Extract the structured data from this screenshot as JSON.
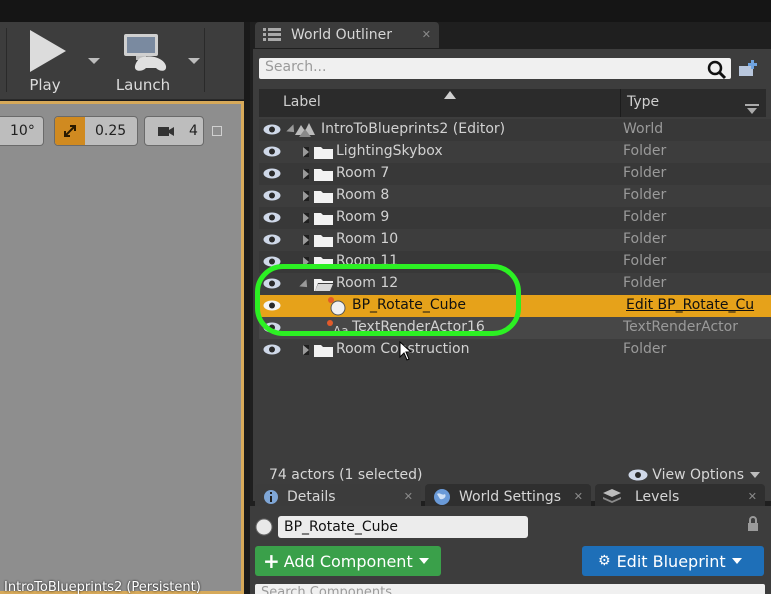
{
  "toolbar": {
    "play_label": "Play",
    "launch_label": "Launch"
  },
  "viewport": {
    "angle_value": "10°",
    "scale_value": "0.25",
    "camera_speed": "4",
    "status_text": "IntroToBlueprints2 (Persistent)"
  },
  "outliner": {
    "tab_label": "World Outliner",
    "search_placeholder": "Search...",
    "col_label": "Label",
    "col_type": "Type",
    "rows": [
      {
        "label": "IntroToBlueprints2 (Editor)",
        "type": "World"
      },
      {
        "label": "LightingSkybox",
        "type": "Folder"
      },
      {
        "label": "Room 7",
        "type": "Folder"
      },
      {
        "label": "Room 8",
        "type": "Folder"
      },
      {
        "label": "Room 9",
        "type": "Folder"
      },
      {
        "label": "Room 10",
        "type": "Folder"
      },
      {
        "label": "Room 11",
        "type": "Folder"
      },
      {
        "label": "Room 12",
        "type": "Folder"
      },
      {
        "label": "BP_Rotate_Cube",
        "type": "Edit BP_Rotate_Cu"
      },
      {
        "label": "TextRenderActor16",
        "type": "TextRenderActor"
      },
      {
        "label": "Room Construction",
        "type": "Folder"
      }
    ],
    "actor_count": "74 actors (1 selected)",
    "view_options": "View Options"
  },
  "lower_tabs": {
    "details": "Details",
    "world_settings": "World Settings",
    "levels": "Levels"
  },
  "details": {
    "object_name": "BP_Rotate_Cube",
    "add_component": "Add Component",
    "edit_blueprint": "Edit Blueprint",
    "search_components": "Search Components"
  },
  "colors": {
    "selection": "#e6a21a",
    "highlight_circle": "#2cf023",
    "add_component_bg": "#3aa04a",
    "edit_blueprint_bg": "#1e6fb8"
  }
}
